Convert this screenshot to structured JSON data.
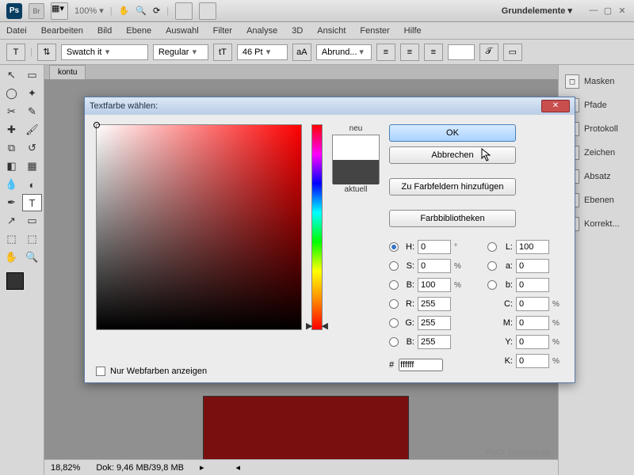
{
  "title": {
    "workspace": "Grundelemente ▾",
    "zoom_toolbar": "100% ▾",
    "br": "Br"
  },
  "menu": [
    "Datei",
    "Bearbeiten",
    "Bild",
    "Ebene",
    "Auswahl",
    "Filter",
    "Analyse",
    "3D",
    "Ansicht",
    "Fenster",
    "Hilfe"
  ],
  "options": {
    "font_family": "Swatch it",
    "font_style": "Regular",
    "font_size": "46 Pt",
    "aa": "Abrund..."
  },
  "doc_tab": "kontu",
  "status": {
    "zoom": "18,82%",
    "dok": "Dok: 9,46 MB/39,8 MB"
  },
  "panels": [
    "Masken",
    "Pfade",
    "Protokoll",
    "Zeichen",
    "Absatz",
    "Ebenen",
    "Korrekt..."
  ],
  "dialog": {
    "title": "Textfarbe wählen:",
    "neu": "neu",
    "aktuell": "aktuell",
    "ok": "OK",
    "cancel": "Abbrechen",
    "add": "Zu Farbfeldern hinzufügen",
    "libs": "Farbbibliotheken",
    "H": "0",
    "S": "0",
    "B": "100",
    "R": "255",
    "G": "255",
    "Bb": "255",
    "L": "100",
    "a": "0",
    "b": "0",
    "C": "0",
    "M": "0",
    "Y": "0",
    "K": "0",
    "hex": "ffffff",
    "webonly": "Nur Webfarben anzeigen"
  },
  "watermark": "PSD-Tutorials.de"
}
